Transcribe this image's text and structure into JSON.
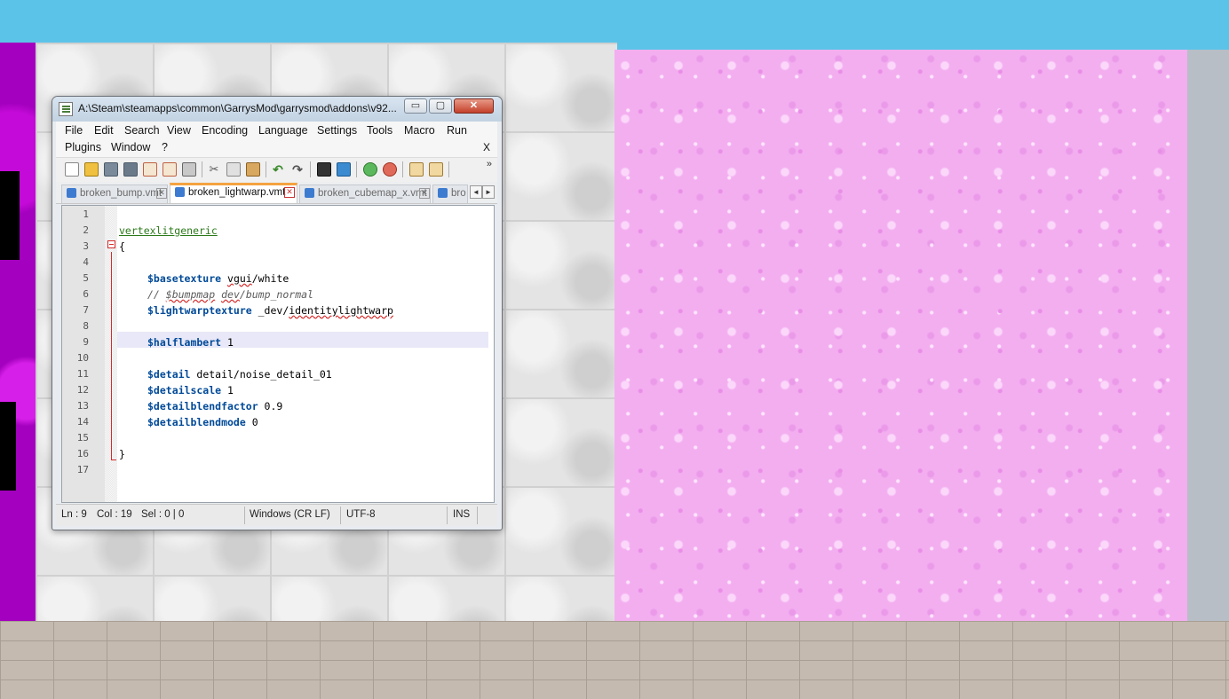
{
  "window": {
    "title": "A:\\Steam\\steamapps\\common\\GarrysMod\\garrysmod\\addons\\v92...",
    "controls": {
      "minimize": "▭",
      "maximize": "▢",
      "close": "✕"
    }
  },
  "menu": {
    "row1": [
      "File",
      "Edit",
      "Search",
      "View",
      "Encoding",
      "Language",
      "Settings",
      "Tools",
      "Macro",
      "Run"
    ],
    "row2": [
      "Plugins",
      "Window",
      "?"
    ],
    "close_doc": "X"
  },
  "toolbar": {
    "icons": [
      "new-file-icon",
      "open-file-icon",
      "save-icon",
      "save-all-icon",
      "close-icon",
      "close-all-icon",
      "print-icon",
      "cut-icon",
      "copy-icon",
      "paste-icon",
      "undo-icon",
      "redo-icon",
      "find-icon",
      "replace-icon",
      "zoom-in-icon",
      "zoom-out-icon",
      "sync-vertical-icon",
      "sync-horizontal-icon"
    ],
    "more": "»"
  },
  "tabs": [
    {
      "label": "broken_bump.vmt",
      "active": false
    },
    {
      "label": "broken_lightwarp.vmt",
      "active": true
    },
    {
      "label": "broken_cubemap_x.vmt",
      "active": false
    },
    {
      "label": "bro",
      "active": false
    }
  ],
  "tab_close": "✕",
  "tab_scroll": {
    "left": "◄",
    "right": "►"
  },
  "editor": {
    "lines": [
      "1",
      "2",
      "3",
      "4",
      "5",
      "6",
      "7",
      "8",
      "9",
      "10",
      "11",
      "12",
      "13",
      "14",
      "15",
      "16",
      "17"
    ],
    "code": {
      "shader": "vertexlitgeneric",
      "open_brace": "{",
      "l5_key": "$basetexture",
      "l5_val_a": "vgui",
      "l5_val_b": "/white",
      "l6_prefix": "// ",
      "l6_a": "$bumpmap",
      "l6_b": "dev",
      "l6_c": "/bump_normal",
      "l7_key": "$lightwarptexture",
      "l7_val_a": " _dev/",
      "l7_val_b": "identitylightwarp",
      "l9_key": "$halflambert",
      "l9_val": " 1",
      "l11_key": "$detail",
      "l11_val": " detail/noise_detail_01",
      "l12_key": "$detailscale",
      "l12_val": " 1",
      "l13_key": "$detailblendfactor",
      "l13_val": " 0.9",
      "l14_key": "$detailblendmode",
      "l14_val": " 0",
      "close_brace": "}"
    },
    "current_line": 9
  },
  "status": {
    "ln": "Ln : 9",
    "col": "Col : 19",
    "sel": "Sel : 0 | 0",
    "eol": "Windows (CR LF)",
    "encoding": "UTF-8",
    "mode": "INS"
  },
  "colors": {
    "sky": "#5cc3e8",
    "pink_wall": "#f3aef0",
    "purple_wall": "#a400bf",
    "keyword": "#004a99",
    "fold_marker": "#d42b2b",
    "active_tab_accent": "#f4a340"
  }
}
